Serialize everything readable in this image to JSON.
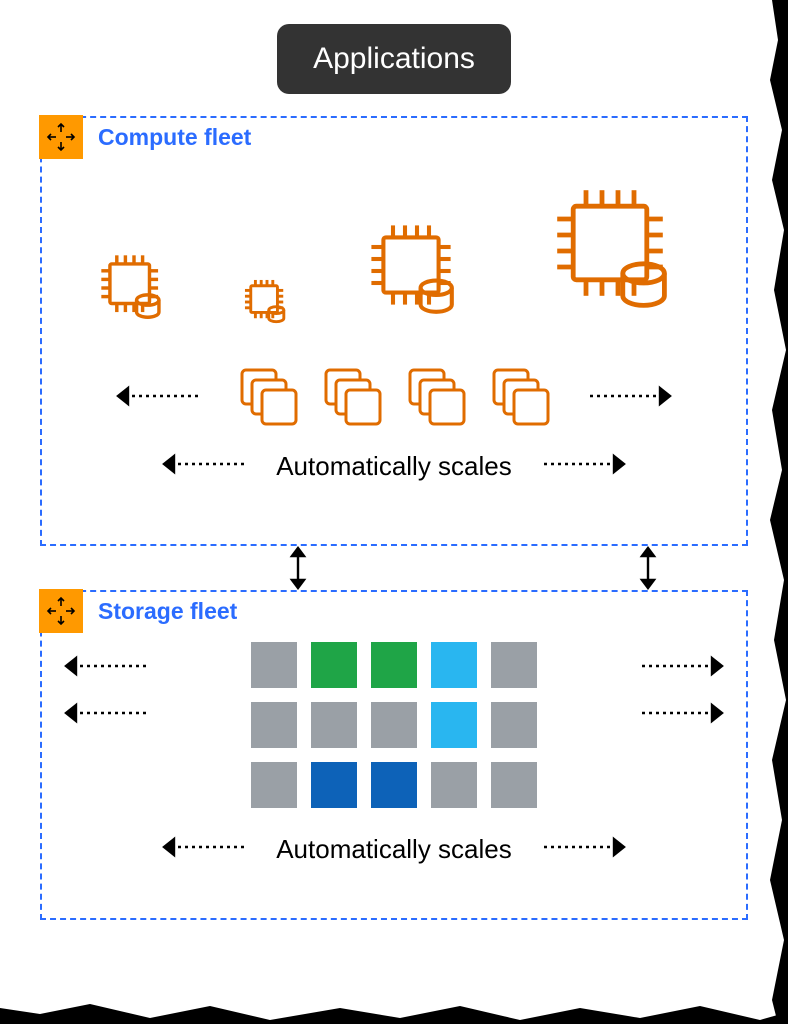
{
  "header": {
    "applications_label": "Applications"
  },
  "compute": {
    "title": "Compute fleet",
    "auto_scales_label": "Automatically scales"
  },
  "storage": {
    "title": "Storage fleet",
    "auto_scales_label": "Automatically scales",
    "grid": [
      [
        "gray",
        "green",
        "green",
        "lblue",
        "gray"
      ],
      [
        "gray",
        "gray",
        "gray",
        "lblue",
        "gray"
      ],
      [
        "gray",
        "dblue",
        "dblue",
        "gray",
        "gray"
      ]
    ]
  },
  "colors": {
    "aws_orange": "#ff9900",
    "aws_stroke": "#e06c00",
    "blue_border": "#2b6cff",
    "gray": "#9aa0a6",
    "green": "#1fa547",
    "light_blue": "#29b6f0",
    "dark_blue": "#0d62b8"
  }
}
